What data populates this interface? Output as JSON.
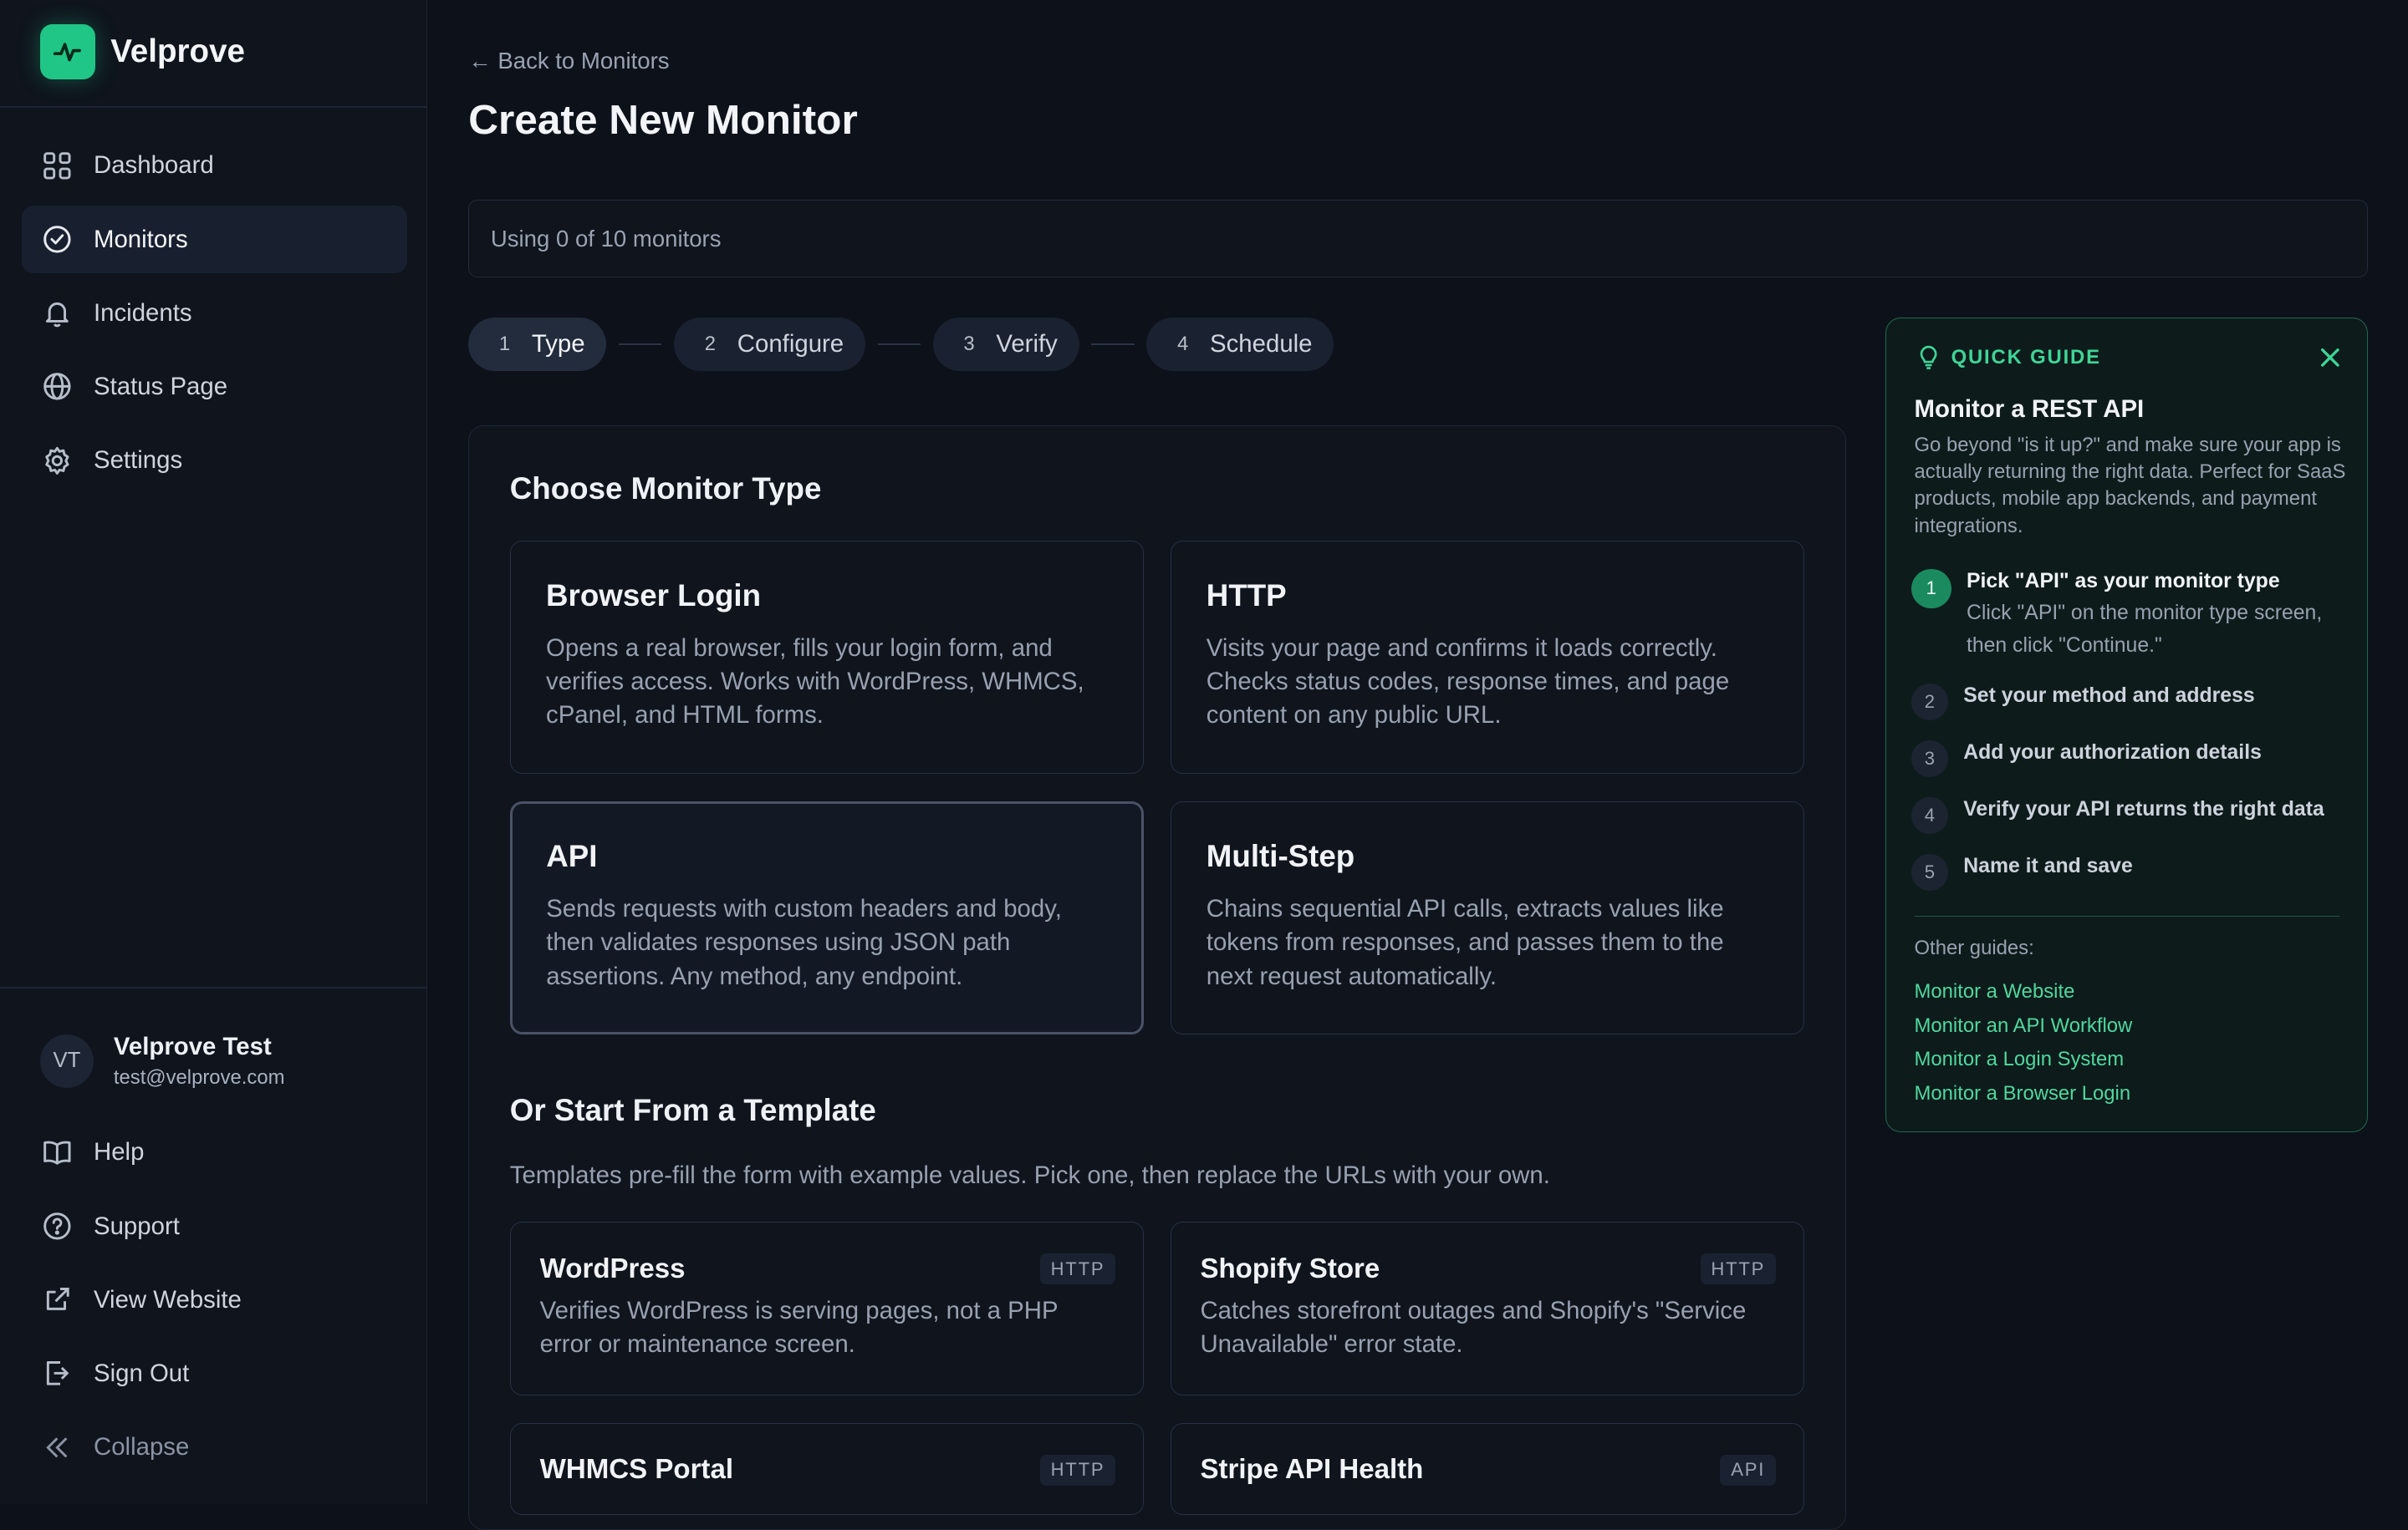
{
  "brand": {
    "name": "Velprove",
    "accent": "#1fc685"
  },
  "nav": [
    {
      "label": "Dashboard",
      "icon": "grid-icon"
    },
    {
      "label": "Monitors",
      "icon": "check-circle-icon",
      "active": true
    },
    {
      "label": "Incidents",
      "icon": "bell-icon"
    },
    {
      "label": "Status Page",
      "icon": "globe-icon"
    },
    {
      "label": "Settings",
      "icon": "gear-icon"
    }
  ],
  "user": {
    "initials": "VT",
    "name": "Velprove Test",
    "email": "test@velprove.com"
  },
  "bottom_nav": {
    "help": "Help",
    "support": "Support",
    "view_website": "View Website",
    "sign_out": "Sign Out",
    "collapse": "Collapse"
  },
  "header": {
    "back": "← Back to Monitors",
    "title": "Create New Monitor",
    "usage": "Using 0 of 10 monitors"
  },
  "steps": [
    {
      "num": "1",
      "label": "Type",
      "active": true
    },
    {
      "num": "2",
      "label": "Configure"
    },
    {
      "num": "3",
      "label": "Verify"
    },
    {
      "num": "4",
      "label": "Schedule"
    }
  ],
  "monitor_types": {
    "heading": "Choose Monitor Type",
    "items": [
      {
        "title": "Browser Login",
        "desc": "Opens a real browser, fills your login form, and verifies access. Works with WordPress, WHMCS, cPanel, and HTML forms."
      },
      {
        "title": "HTTP",
        "desc": "Visits your page and confirms it loads correctly. Checks status codes, response times, and page content on any public URL."
      },
      {
        "title": "API",
        "desc": "Sends requests with custom headers and body, then validates responses using JSON path assertions. Any method, any endpoint.",
        "selected": true
      },
      {
        "title": "Multi-Step",
        "desc": "Chains sequential API calls, extracts values like tokens from responses, and passes them to the next request automatically."
      }
    ]
  },
  "templates": {
    "heading": "Or Start From a Template",
    "intro": "Templates pre-fill the form with example values. Pick one, then replace the URLs with your own.",
    "items": [
      {
        "title": "WordPress",
        "badge": "HTTP",
        "desc": "Verifies WordPress is serving pages, not a PHP error or maintenance screen."
      },
      {
        "title": "Shopify Store",
        "badge": "HTTP",
        "desc": "Catches storefront outages and Shopify's \"Service Unavailable\" error state."
      },
      {
        "title": "WHMCS Portal",
        "badge": "HTTP",
        "desc": ""
      },
      {
        "title": "Stripe API Health",
        "badge": "API",
        "desc": ""
      }
    ]
  },
  "guide": {
    "label": "QUICK GUIDE",
    "title": "Monitor a REST API",
    "desc": "Go beyond \"is it up?\" and make sure your app is actually returning the right data. Perfect for SaaS products, mobile app backends, and payment integrations.",
    "steps": [
      {
        "num": "1",
        "title": "Pick \"API\" as your monitor type",
        "sub": "Click \"API\" on the monitor type screen, then click \"Continue.\"",
        "active": true
      },
      {
        "num": "2",
        "title": "Set your method and address"
      },
      {
        "num": "3",
        "title": "Add your authorization details"
      },
      {
        "num": "4",
        "title": "Verify your API returns the right data"
      },
      {
        "num": "5",
        "title": "Name it and save"
      }
    ],
    "other_label": "Other guides:",
    "other_links": [
      "Monitor a Website",
      "Monitor an API Workflow",
      "Monitor a Login System",
      "Monitor a Browser Login"
    ]
  }
}
